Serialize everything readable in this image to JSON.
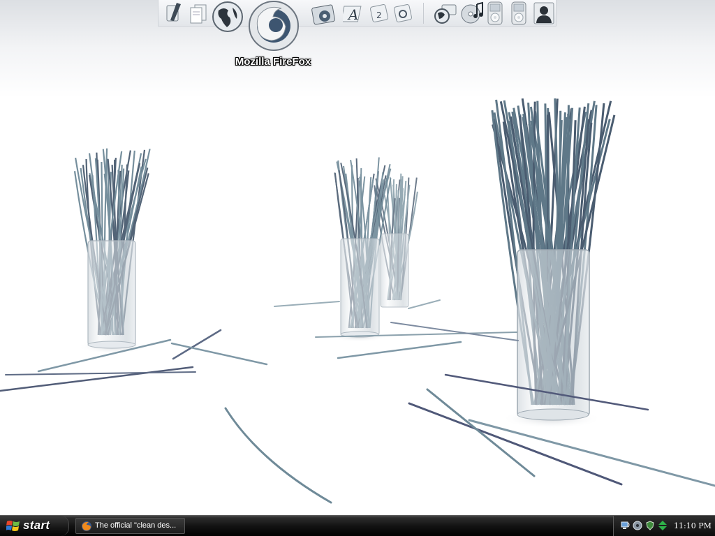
{
  "dock": {
    "tooltip": "Mozilla FireFox",
    "icons": [
      "pen-icon",
      "documents-icon",
      "globe-icon",
      "firefox-icon",
      "music-player-icon",
      "font-icon",
      "calculator-icon",
      "settings-icon",
      "network-icon",
      "cd-music-icon",
      "ipod-icon",
      "ipod-icon",
      "user-icon"
    ]
  },
  "taskbar": {
    "start_label": "start",
    "task_label": "The official \"clean des...",
    "clock": "11:10 PM",
    "tray_icons": [
      "network-tray-icon",
      "volume-tray-icon",
      "shield-tray-icon",
      "update-tray-icon"
    ]
  },
  "colors": {
    "taskbar": "#000000",
    "straw": "#6f8a98",
    "straw_dark": "#4a5c70",
    "desktop": "#ffffff"
  }
}
